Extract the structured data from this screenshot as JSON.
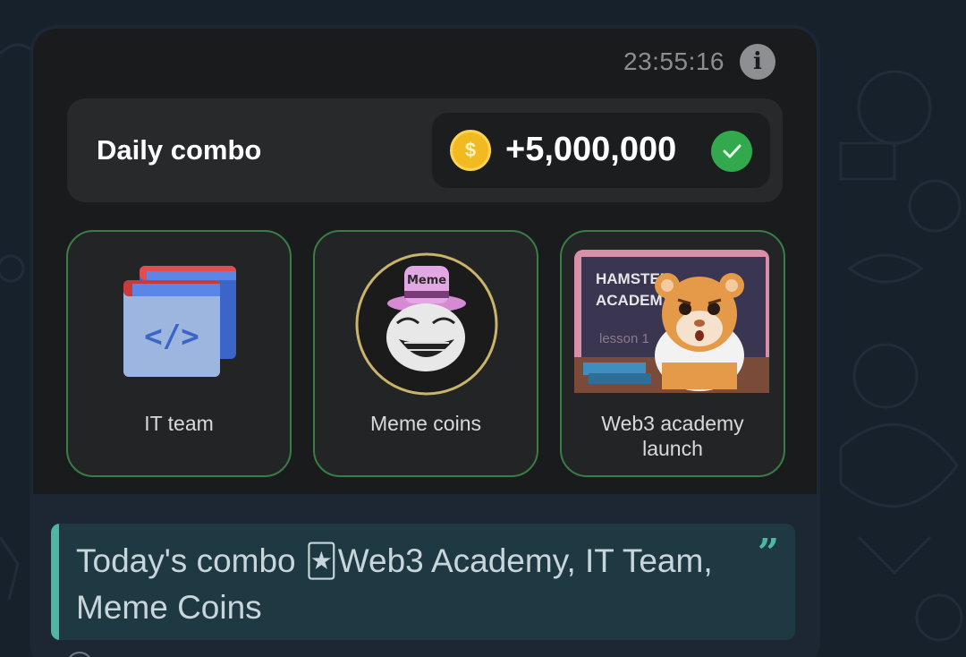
{
  "screen": {
    "time": "23:55:16",
    "combo_title": "Daily combo",
    "reward": "+5,000,000",
    "coin_symbol": "$",
    "cards": [
      {
        "label": "IT team",
        "icon": "code-window-icon"
      },
      {
        "label": "Meme coins",
        "icon": "meme-hat-troll-face-icon",
        "hat_text": "Meme"
      },
      {
        "label": "Web3 academy launch",
        "icon": "hamster-academy-image",
        "board_line1": "HAMSTER",
        "board_line2": "ACADEMY",
        "board_line3": "lesson 1"
      }
    ]
  },
  "caption": {
    "text_before": "Today's combo ",
    "emoji": "🃏",
    "text_after": "Web3 Academy, IT Team, Meme Coins",
    "quote_mark": "”"
  },
  "colors": {
    "card_border": "#3a7d44",
    "check_green": "#31a94c",
    "coin_gold": "#f3b921",
    "quote_accent": "#4fb6a3",
    "chat_background": "#17212b"
  }
}
